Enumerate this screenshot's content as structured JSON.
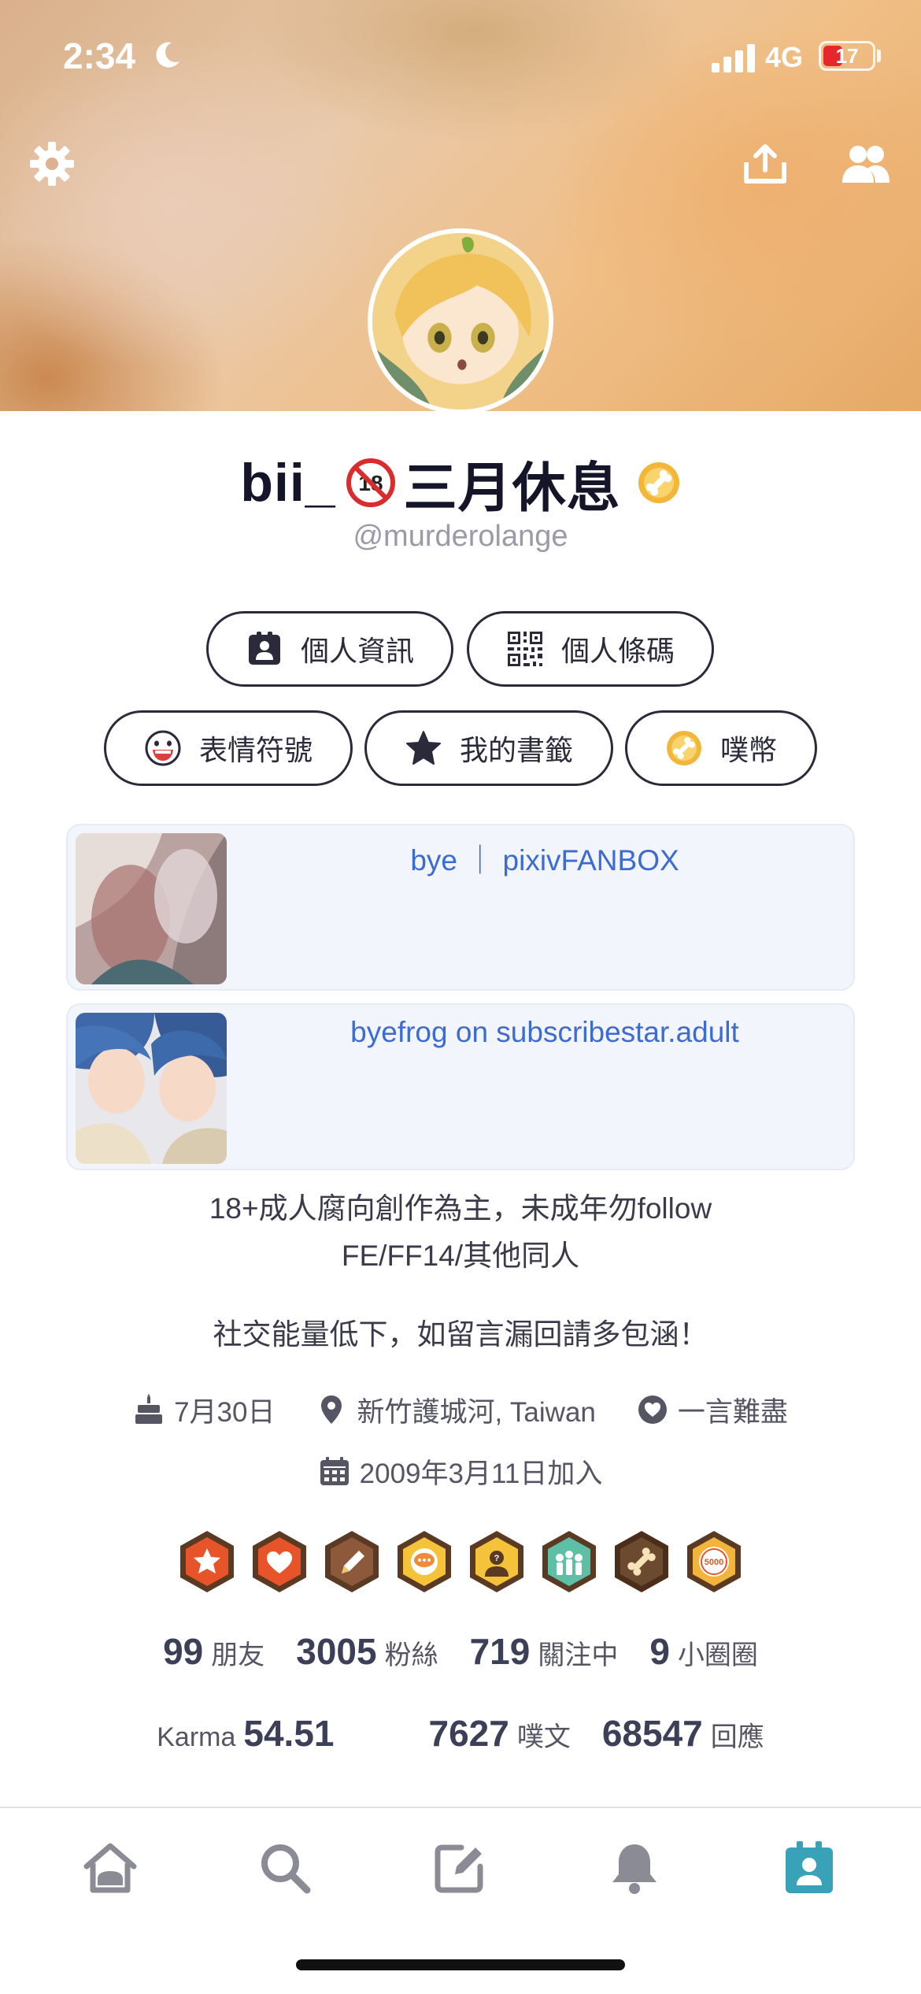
{
  "status_bar": {
    "time": "2:34",
    "network": "4G",
    "battery": "17"
  },
  "profile": {
    "display_name": "bii_",
    "display_name_suffix": "三月休息",
    "username": "@murderolange"
  },
  "actions": {
    "profile_info": "個人資訊",
    "qr_code": "個人條碼",
    "emoticons": "表情符號",
    "bookmarks": "我的書籤",
    "coins": "噗幣"
  },
  "links": [
    {
      "title": "bye ｜ pixivFANBOX"
    },
    {
      "title": "byefrog on subscribestar.adult"
    }
  ],
  "bio": {
    "line1": "18+成人腐向創作為主，未成年勿follow",
    "line2": "FE/FF14/其他同人",
    "line3": "社交能量低下，如留言漏回請多包涵！"
  },
  "meta": {
    "birthday": "7月30日",
    "location": "新竹護城河, Taiwan",
    "relationship": "一言難盡",
    "joined": "2009年3月11日加入"
  },
  "badges": [
    {
      "name": "star-badge",
      "color": "#e8542a"
    },
    {
      "name": "heart-badge",
      "color": "#e8542a"
    },
    {
      "name": "pencil-badge",
      "color": "#8c5a3a"
    },
    {
      "name": "chat-badge",
      "color": "#f4c33a"
    },
    {
      "name": "question-badge",
      "color": "#f4c33a"
    },
    {
      "name": "crowd-badge",
      "color": "#5dbfa6"
    },
    {
      "name": "bone-badge",
      "color": "#6b4a30"
    },
    {
      "name": "5000-badge",
      "color": "#f2b43a",
      "text": "5000"
    }
  ],
  "stats": {
    "friends": {
      "value": "99",
      "label": "朋友"
    },
    "fans": {
      "value": "3005",
      "label": "粉絲"
    },
    "following": {
      "value": "719",
      "label": "關注中"
    },
    "cliques": {
      "value": "9",
      "label": "小圈圈"
    },
    "karma": {
      "value": "54.51",
      "label": "Karma"
    },
    "plurks": {
      "value": "7627",
      "label": "噗文"
    },
    "responses": {
      "value": "68547",
      "label": "回應"
    }
  },
  "colors": {
    "accent": "#3aa2b8",
    "link": "#3b6bd3",
    "icon_gray": "#8b8b96"
  }
}
